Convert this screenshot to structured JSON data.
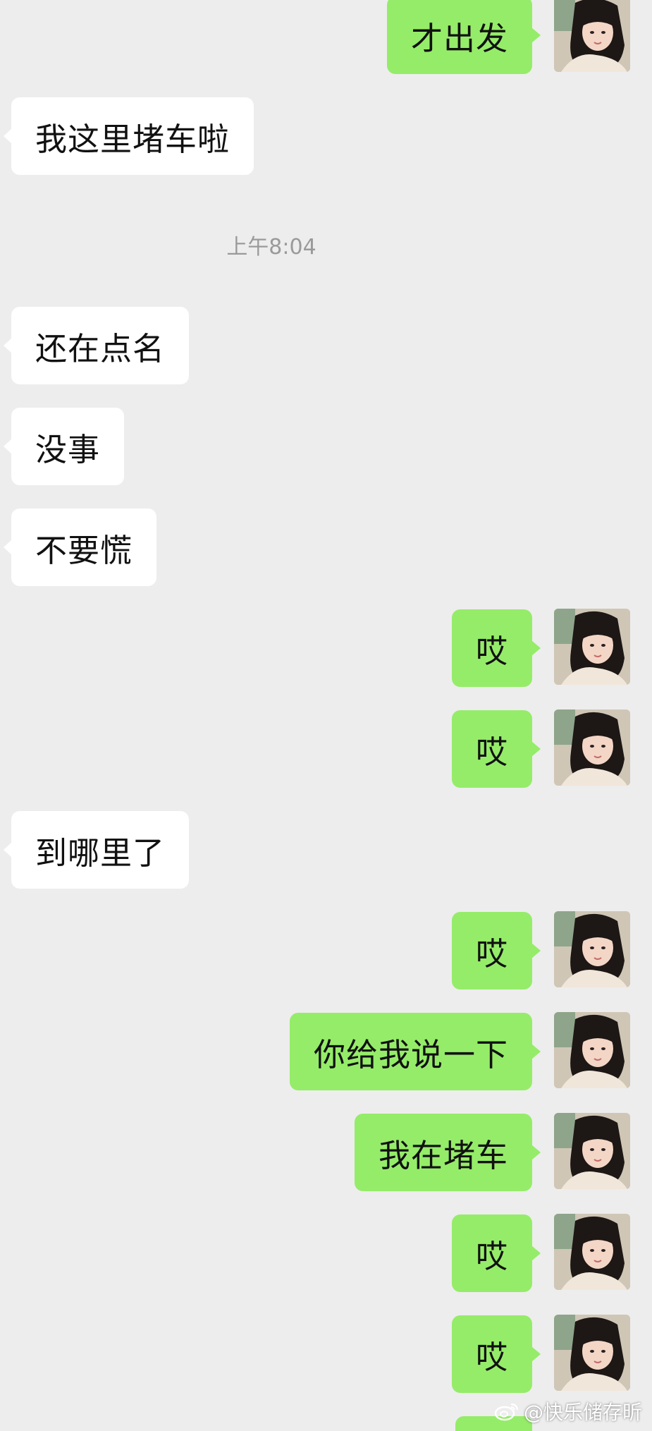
{
  "chat": {
    "timestamp": "上午8:04",
    "messages": [
      {
        "side": "out",
        "text": "才出发"
      },
      {
        "side": "in",
        "text": "我这里堵车啦"
      },
      {
        "side": "in",
        "text": "还在点名"
      },
      {
        "side": "in",
        "text": "没事"
      },
      {
        "side": "in",
        "text": "不要慌"
      },
      {
        "side": "out",
        "text": "哎"
      },
      {
        "side": "out",
        "text": "哎"
      },
      {
        "side": "in",
        "text": "到哪里了"
      },
      {
        "side": "out",
        "text": "哎"
      },
      {
        "side": "out",
        "text": "你给我说一下"
      },
      {
        "side": "out",
        "text": "我在堵车"
      },
      {
        "side": "out",
        "text": "哎"
      },
      {
        "side": "out",
        "text": "哎"
      }
    ]
  },
  "watermark": {
    "text": "@快乐储存昕",
    "icon": "weibo-icon"
  },
  "colors": {
    "background": "#ededed",
    "incoming_bubble": "#ffffff",
    "outgoing_bubble": "#95ec69",
    "timestamp_text": "#9a9a9a"
  }
}
